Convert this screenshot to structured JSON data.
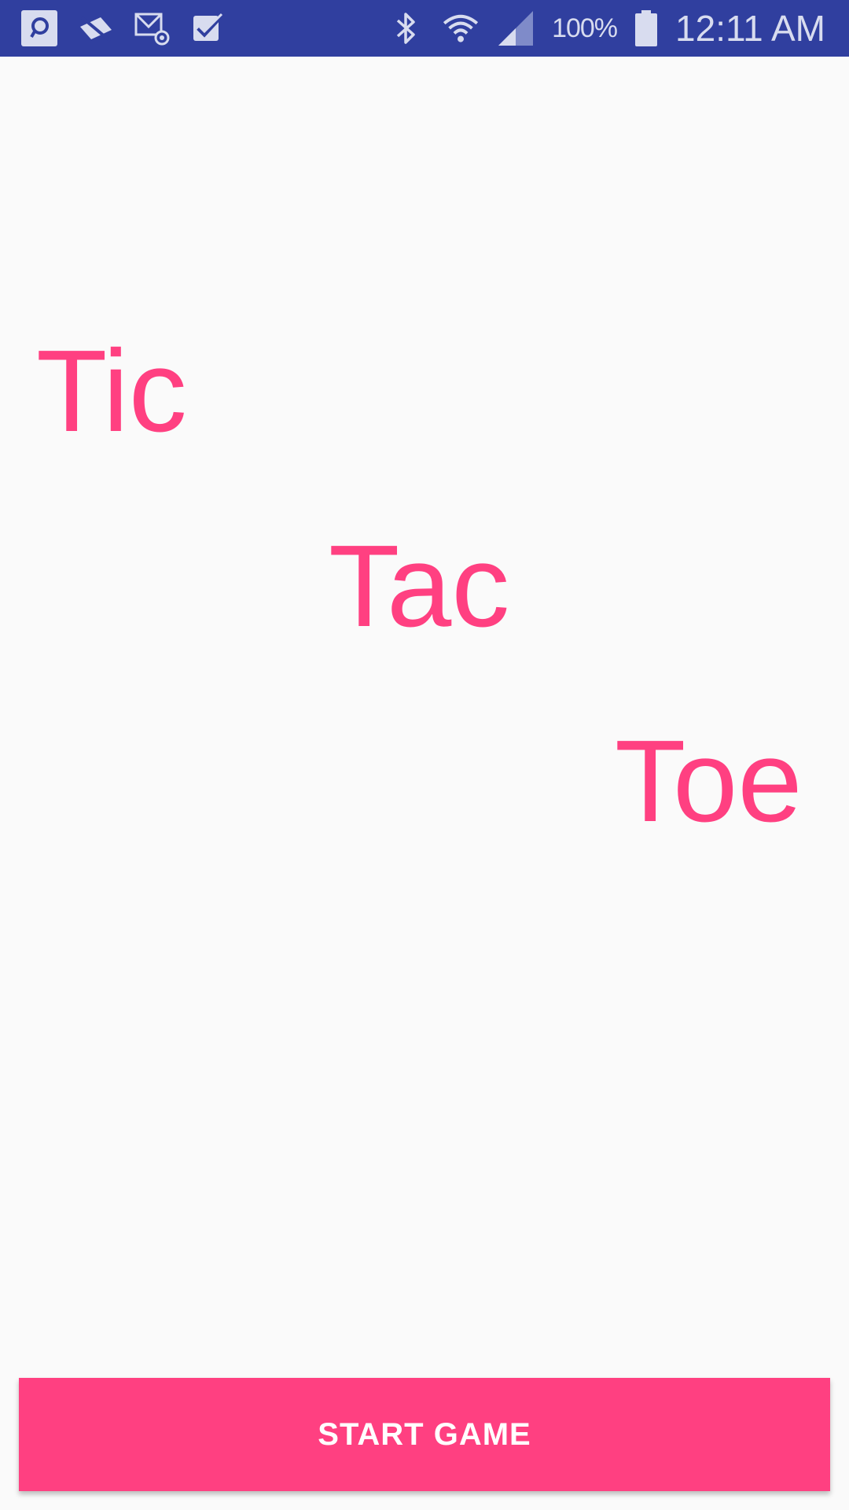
{
  "status_bar": {
    "left_icons": [
      "chat-app-icon",
      "no-sim-icon",
      "email-icon",
      "tasks-check-icon"
    ],
    "right_icons": [
      "bluetooth-icon",
      "wifi-icon",
      "signal-icon",
      "battery-icon"
    ],
    "battery_percent": "100%",
    "time": "12:11 AM",
    "background_color": "#303f9f",
    "icon_color": "#d8dcef"
  },
  "title_words": {
    "first": "Tic",
    "second": "Tac",
    "third": "Toe",
    "color": "#ff4081"
  },
  "start_button": {
    "label": "START GAME",
    "color": "#ff4081"
  }
}
